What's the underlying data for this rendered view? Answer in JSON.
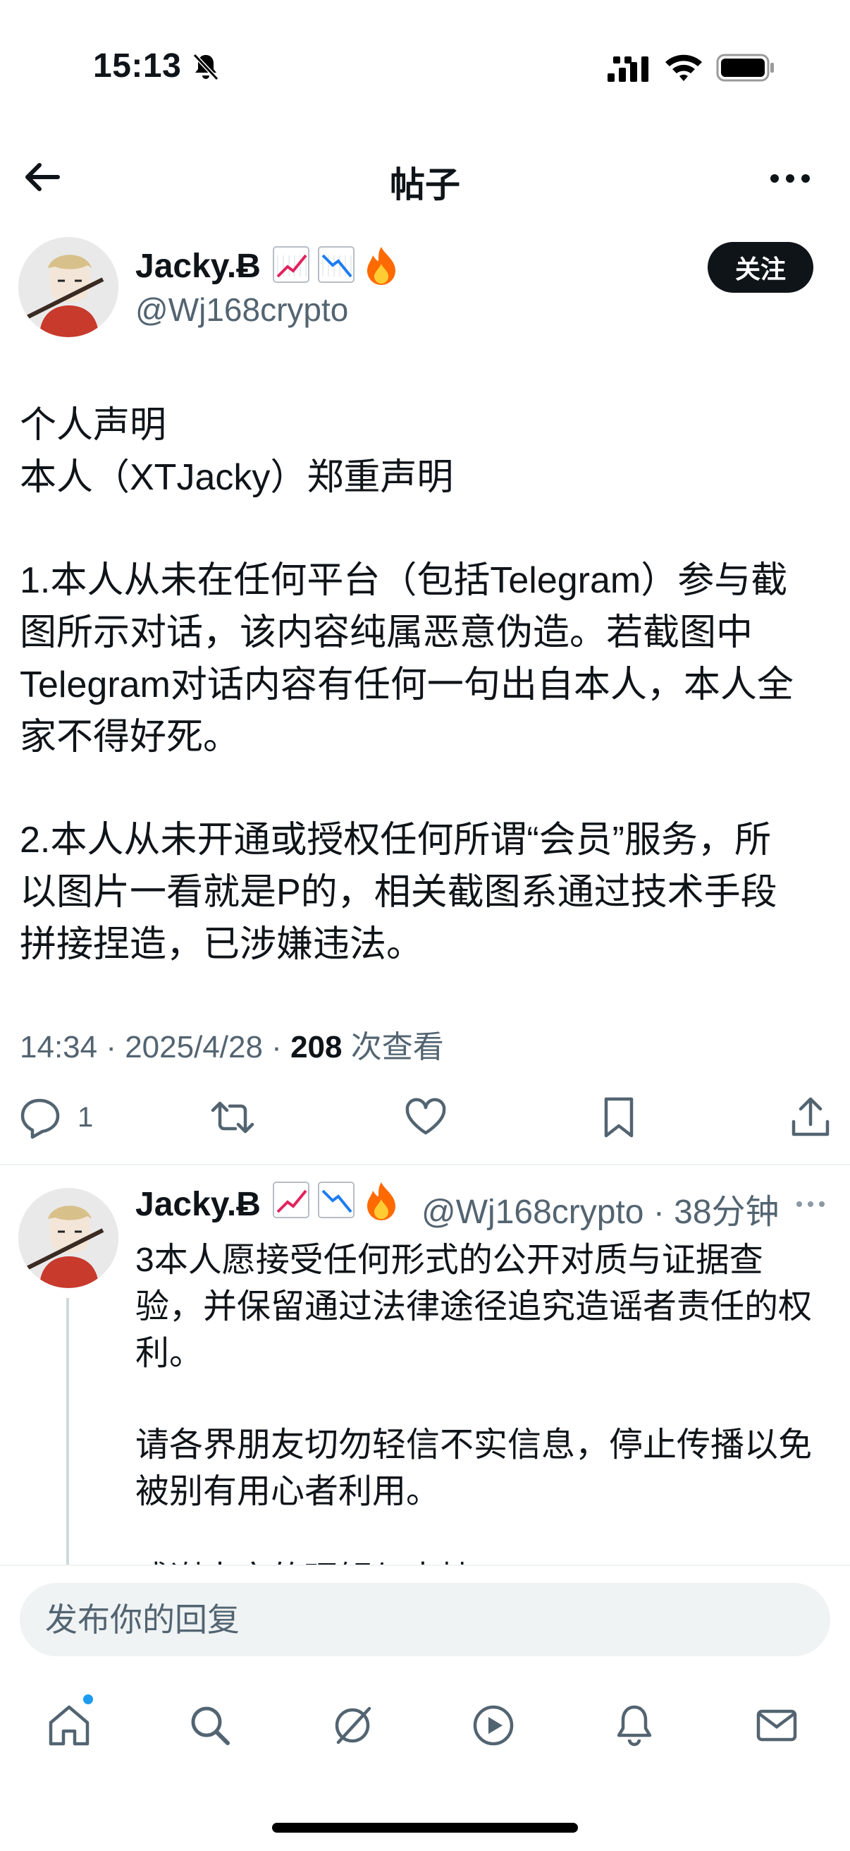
{
  "status_bar": {
    "time": "15:13"
  },
  "header": {
    "title": "帖子"
  },
  "post": {
    "author_name": "Jacky.Ƀ",
    "author_handle": "@Wj168crypto",
    "follow_label": "关注",
    "lines": [
      "个人声明",
      "本人（XTJacky）郑重声明",
      "1.本人从未在任何平台（包括Telegram）参与截",
      "图所示对话，该内容纯属恶意伪造。若截图中",
      "Telegram对话内容有任何一句出自本人，本人全",
      "家不得好死。",
      "2.本人从未开通或授权任何所谓“会员”服务，所",
      "以图片一看就是P的，相关截图系通过技术手段",
      "拼接捏造，已涉嫌违法。"
    ],
    "timestamp": "14:34 · 2025/4/28 · ",
    "views_count": "208",
    "views_label": " 次查看",
    "reply_count": "1"
  },
  "reply": {
    "author_name": "Jacky.Ƀ",
    "handle_time": "@Wj168crypto · 38分钟",
    "lines": [
      "3本人愿接受任何形式的公开对质与证据查",
      "验，并保留通过法律途径追究造谣者责任的权",
      "利。",
      "请各界朋友切勿轻信不实信息，停止传播以免",
      "被别有用心者利用。",
      "感谢大家的理解与支持！"
    ]
  },
  "composer": {
    "placeholder": "发布你的回复"
  },
  "colors": {
    "accent": "#1d9bf0",
    "text": "#0f1419",
    "secondary": "#536471",
    "fire": "#ff6a00"
  }
}
